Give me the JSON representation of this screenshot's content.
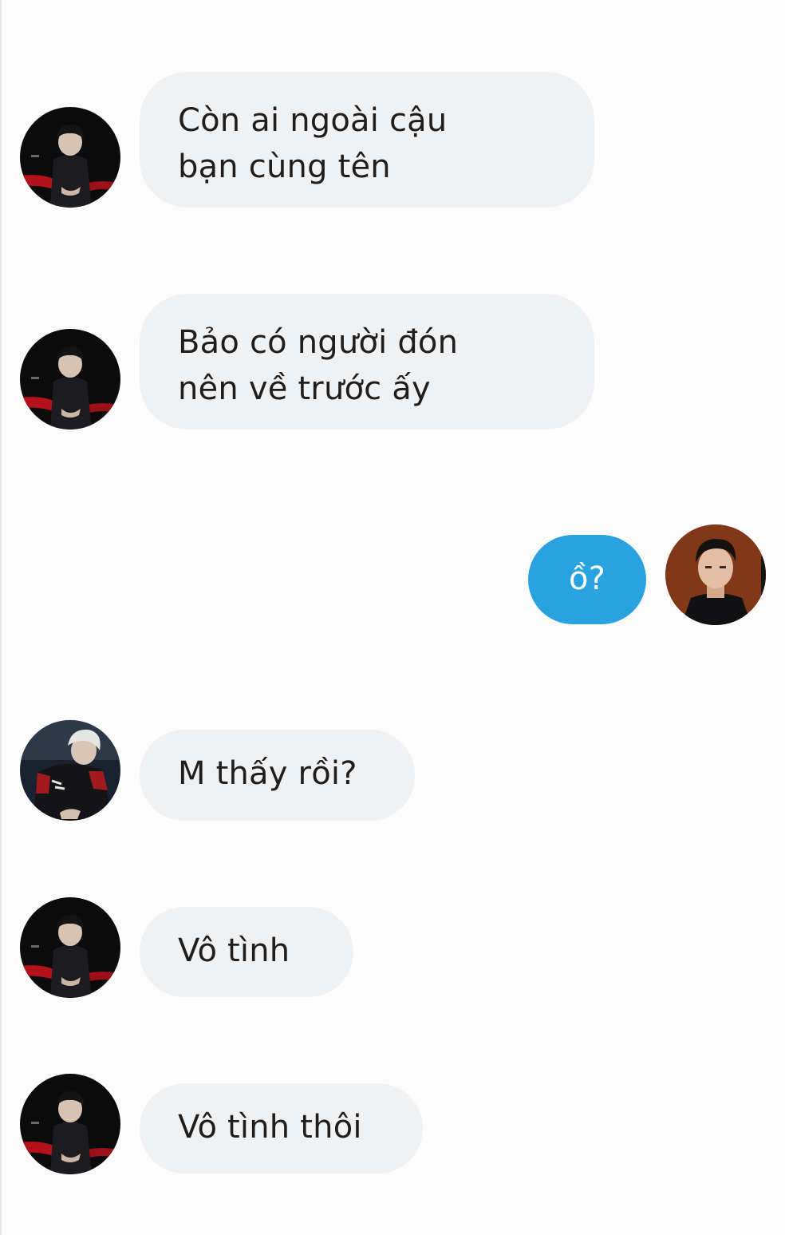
{
  "conversation": {
    "messages": [
      {
        "sender": "friend-1",
        "direction": "incoming",
        "text": "Còn ai ngoài cậu\nbạn cùng tên"
      },
      {
        "sender": "friend-1",
        "direction": "incoming",
        "text": "Bảo có người đón\nnên về trước ấy"
      },
      {
        "sender": "me",
        "direction": "outgoing",
        "text": "ồ?"
      },
      {
        "sender": "friend-2",
        "direction": "incoming",
        "text": "M thấy rồi?"
      },
      {
        "sender": "friend-1",
        "direction": "incoming",
        "text": "Vô tình"
      },
      {
        "sender": "friend-1",
        "direction": "incoming",
        "text": "Vô tình thôi"
      }
    ]
  },
  "colors": {
    "background": "#fcfcfd",
    "incoming_bubble": "#f0f1f3",
    "outgoing_bubble": "#29a3e0",
    "incoming_text": "#1e1e1e",
    "outgoing_text": "#ffffff"
  },
  "icons": {
    "friend-1": "avatar-photo-dark-stage",
    "friend-2": "avatar-photo-blond-jacket",
    "me": "avatar-photo-brown-portrait"
  }
}
